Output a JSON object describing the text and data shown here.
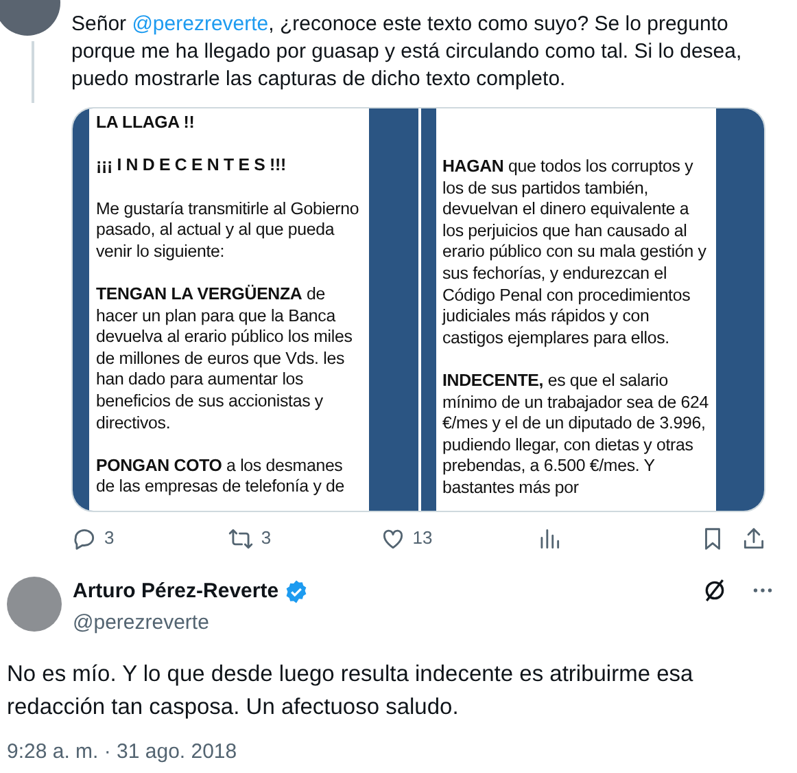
{
  "parent_tweet": {
    "text": "Señor **@perezreverte**, ¿reconoce este texto como suyo? Se lo pregunto porque me ha llegado por guasap y está circulando como tal. Si lo desea, puedo mostrarle las capturas de dicho texto completo.",
    "media": [
      {
        "paragraphs": [
          {
            "kind": "heading",
            "text": "LA LLAGA !!"
          },
          {
            "kind": "heading",
            "text": "¡¡¡ I N D E C E N T E S !!!"
          },
          {
            "kind": "body",
            "text": "Me gustaría transmitirle al Gobierno pasado, al actual y al que pueda venir lo siguiente:"
          },
          {
            "kind": "body",
            "text": "**TENGAN LA VERGÜENZA** de hacer un plan para que la Banca devuelva al erario público los miles de millones de euros que Vds. les han dado para aumentar los beneficios de sus accionistas y directivos."
          },
          {
            "kind": "body",
            "text": "**PONGAN COTO** a los desmanes de las empresas de telefonía y de"
          }
        ]
      },
      {
        "paragraphs": [
          {
            "kind": "body",
            "text": "**HAGAN** que todos los corruptos y los de sus partidos también, devuelvan el dinero equivalente a los perjuicios que han causado al erario público con su mala gestión y sus fechorías, y endurezcan el Código Penal con procedimientos judiciales más rápidos y con castigos ejemplares para ellos."
          },
          {
            "kind": "body",
            "text": "**INDECENTE,** es que el salario mínimo de un trabajador sea de 624 €/mes y el de un diputado de 3.996, pudiendo llegar, con dietas y otras prebendas, a 6.500 €/mes. Y bastantes más por"
          }
        ]
      }
    ],
    "actions": [
      {
        "kind": "reply",
        "count": "3"
      },
      {
        "kind": "retweet",
        "count": "3"
      },
      {
        "kind": "like",
        "count": "13"
      },
      {
        "kind": "views"
      },
      {
        "kind": "bookmark"
      },
      {
        "kind": "share"
      }
    ]
  },
  "reply_tweet": {
    "name": "Arturo Pérez-Reverte",
    "verified": true,
    "handle": "@perezreverte",
    "text": "No es mío. Y lo que desde luego resulta indecente es atribuirme esa redacción tan casposa. Un afectuoso saludo.",
    "timestamp": "9:28 a. m. · 31 ago. 2018"
  }
}
